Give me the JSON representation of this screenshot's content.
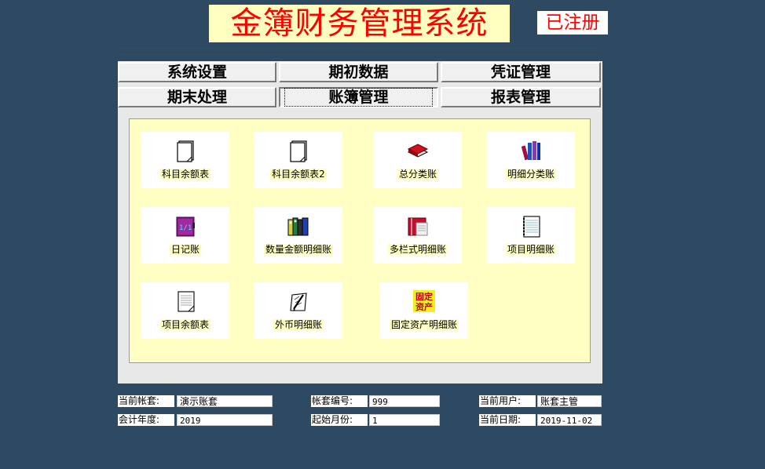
{
  "header": {
    "title": "金簿财务管理系统",
    "registered": "已注册"
  },
  "tabs": {
    "row1": [
      "系统设置",
      "期初数据",
      "凭证管理"
    ],
    "row2": [
      "期末处理",
      "账簿管理",
      "报表管理"
    ],
    "active": "账簿管理"
  },
  "tiles": [
    {
      "label": "科目余额表",
      "icon": "document-icon"
    },
    {
      "label": "科目余额表2",
      "icon": "document-icon"
    },
    {
      "label": "总分类账",
      "icon": "red-book-icon"
    },
    {
      "label": "明细分类账",
      "icon": "books-icon"
    },
    {
      "label": "日记账",
      "icon": "diary-icon"
    },
    {
      "label": "数量金额明细账",
      "icon": "binders-icon"
    },
    {
      "label": "多栏式明细账",
      "icon": "open-book-icon"
    },
    {
      "label": "项目明细账",
      "icon": "notebook-icon"
    },
    {
      "label": "项目余额表",
      "icon": "ledger-page-icon"
    },
    {
      "label": "外币明细账",
      "icon": "pen-paper-icon"
    },
    {
      "label": "固定资产明细账",
      "icon": "fixed-asset-icon",
      "icon_text": "固定\n资产"
    }
  ],
  "info": {
    "account_set_label": "当前帐套:",
    "account_set": "演示账套",
    "set_number_label": "帐套编号:",
    "set_number": "999",
    "user_label": "当前用户:",
    "user": "账套主管",
    "fiscal_year_label": "会计年度:",
    "fiscal_year": "2019",
    "start_month_label": "起始月份:",
    "start_month": "1",
    "date_label": "当前日期:",
    "date": "2019-11-02"
  },
  "colors": {
    "background": "#2e4a62",
    "title_text": "#ff0000",
    "title_bg": "#ffffc0",
    "content_bg": "#ffffc4"
  }
}
